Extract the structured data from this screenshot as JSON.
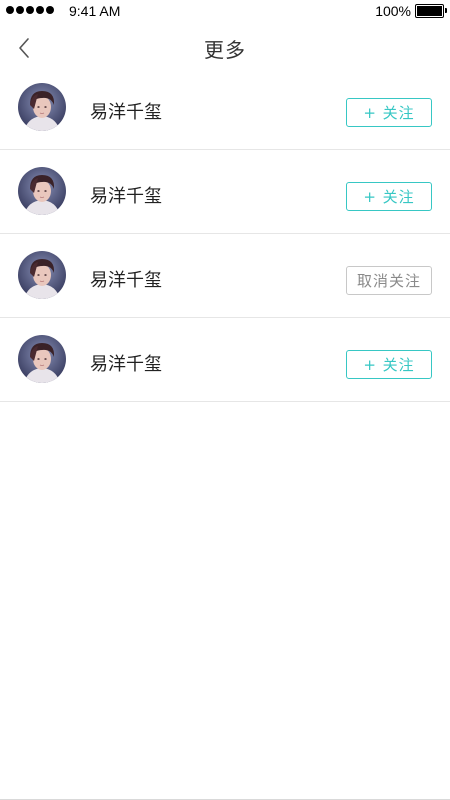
{
  "status_bar": {
    "time": "9:41 AM",
    "battery": "100%",
    "battery_level": 1.0,
    "signal_dots": 5
  },
  "nav": {
    "title": "更多",
    "back_icon": "chevron-left-icon"
  },
  "list": [
    {
      "name": "易洋千玺",
      "button": "+ 关注",
      "following": false
    },
    {
      "name": "易洋千玺",
      "button": "+ 关注",
      "following": false
    },
    {
      "name": "易洋千玺",
      "button": "取消关注",
      "following": true
    },
    {
      "name": "易洋千玺",
      "button": "+ 关注",
      "following": false
    }
  ],
  "colors": {
    "accent": "#37c7c4",
    "unfollow_border": "#c8c8c8",
    "unfollow_text": "#8a8a8a",
    "divider": "#e6e6e6"
  }
}
